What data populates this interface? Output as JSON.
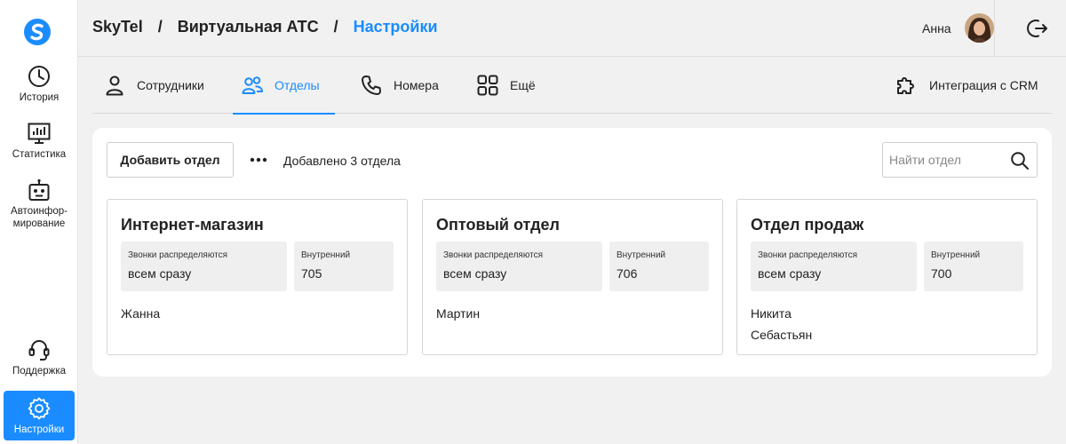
{
  "sidebar": {
    "items": [
      {
        "label": "История",
        "icon": "clock-icon"
      },
      {
        "label": "Статистика",
        "icon": "chart-icon"
      },
      {
        "label": "Автоинфор-мирование",
        "icon": "robot-icon"
      },
      {
        "label": "Поддержка",
        "icon": "headset-icon"
      },
      {
        "label": "Настройки",
        "icon": "gear-icon",
        "active": true
      }
    ]
  },
  "header": {
    "breadcrumb": [
      "SkyTel",
      "Виртуальная АТС",
      "Настройки"
    ],
    "user_name": "Анна"
  },
  "tabs": [
    {
      "label": "Сотрудники",
      "icon": "user-icon"
    },
    {
      "label": "Отделы",
      "icon": "users-icon",
      "active": true
    },
    {
      "label": "Номера",
      "icon": "phone-icon"
    },
    {
      "label": "Ещё",
      "icon": "grid-icon"
    },
    {
      "label": "Интеграция с CRM",
      "icon": "puzzle-icon"
    }
  ],
  "toolbar": {
    "add_label": "Добавить отдел",
    "added_text": "Добавлено 3 отдела",
    "search_placeholder": "Найти отдел"
  },
  "departments": [
    {
      "name": "Интернет-магазин",
      "dist_label": "Звонки распределяются",
      "dist_value": "всем сразу",
      "ext_label": "Внутренний",
      "ext_value": "705",
      "members": [
        "Жанна"
      ]
    },
    {
      "name": "Оптовый отдел",
      "dist_label": "Звонки распределяются",
      "dist_value": "всем сразу",
      "ext_label": "Внутренний",
      "ext_value": "706",
      "members": [
        "Мартин"
      ]
    },
    {
      "name": "Отдел продаж",
      "dist_label": "Звонки распределяются",
      "dist_value": "всем сразу",
      "ext_label": "Внутренний",
      "ext_value": "700",
      "members": [
        "Никита",
        "Себастьян"
      ]
    }
  ],
  "colors": {
    "accent": "#1a8cff",
    "background": "#f1f1f1",
    "field": "#efefef"
  }
}
